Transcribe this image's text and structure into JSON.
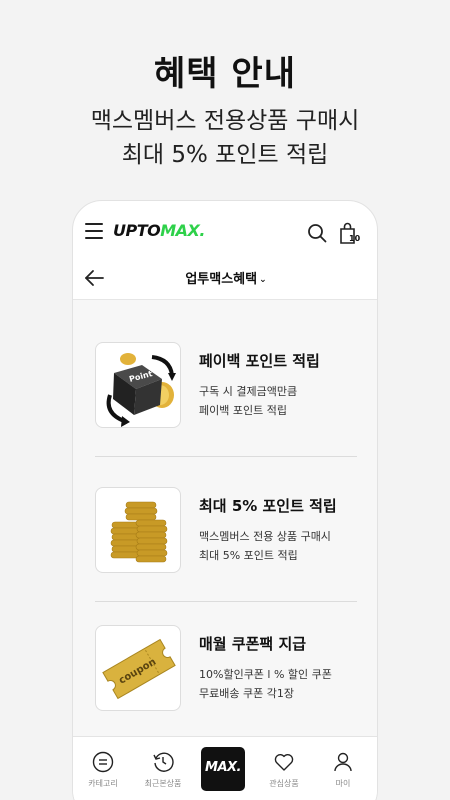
{
  "hero": {
    "title": "혜택 안내",
    "subtitle_line1": "맥스멤버스 전용상품 구매시",
    "subtitle_line2": "최대 5% 포인트 적립"
  },
  "topbar": {
    "logo_main": "UPTO",
    "logo_accent": "MAX.",
    "cart_count": "10"
  },
  "subbar": {
    "title": "업투맥스혜택",
    "dropdown_glyph": "⌄"
  },
  "benefits": [
    {
      "title": "페이백 포인트 적립",
      "desc_line1": "구독 시 결제금액만큼",
      "desc_line2": "페이백 포인트 적립",
      "image_label": "Point"
    },
    {
      "title": "최대 5% 포인트 적립",
      "desc_line1": "맥스멤버스 전용 상품 구매시",
      "desc_line2": "최대 5% 포인트 적립"
    },
    {
      "title": "매월 쿠폰팩 지급",
      "desc_line1": "10%할인쿠폰 l % 할인 쿠폰",
      "desc_line2": "무료배송 쿠폰 각1장",
      "image_label": "coupon"
    }
  ],
  "bottom_nav": {
    "items": [
      {
        "label": "카테고리",
        "icon": "category-icon"
      },
      {
        "label": "최근본상품",
        "icon": "recent-icon"
      },
      {
        "label": "관심상품",
        "icon": "heart-icon"
      },
      {
        "label": "마이",
        "icon": "user-icon"
      }
    ],
    "center_logo": "MAX."
  },
  "colors": {
    "accent": "#2ed14a",
    "background": "#f3f3f3",
    "gold": "#d4a62a"
  }
}
